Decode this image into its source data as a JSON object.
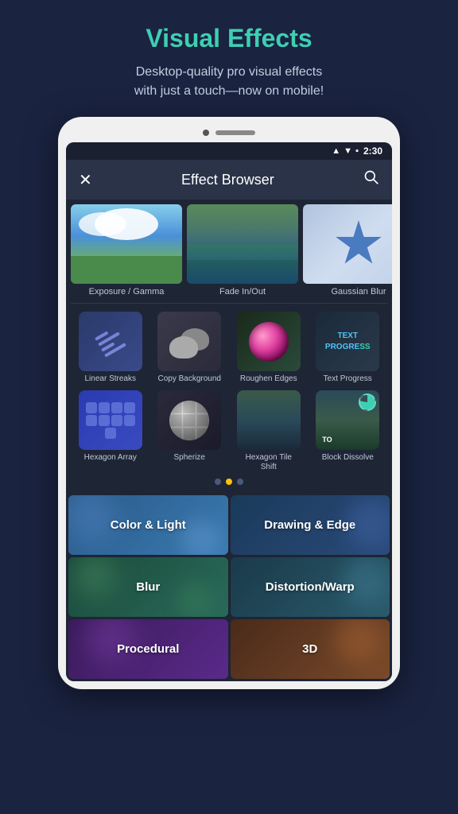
{
  "page": {
    "title": "Visual Effects",
    "subtitle": "Desktop-quality pro visual effects\nwith just a touch—now on mobile!"
  },
  "statusBar": {
    "time": "2:30"
  },
  "appBar": {
    "title": "Effect Browser",
    "closeIcon": "×",
    "searchIcon": "🔍"
  },
  "featuredEffects": [
    {
      "name": "Exposure / Gamma",
      "thumb": "sky"
    },
    {
      "name": "Fade In/Out",
      "thumb": "lake"
    },
    {
      "name": "Gaussian Blur",
      "thumb": "star"
    }
  ],
  "gridEffects": [
    {
      "name": "Linear Streaks",
      "thumb": "linear"
    },
    {
      "name": "Copy Background",
      "thumb": "copy"
    },
    {
      "name": "Roughen Edges",
      "thumb": "roughen"
    },
    {
      "name": "Text Progress",
      "thumb": "text"
    },
    {
      "name": "Hexagon Array",
      "thumb": "hexarray"
    },
    {
      "name": "Spherize",
      "thumb": "sphere"
    },
    {
      "name": "Hexagon Tile Shift",
      "thumb": "hextile"
    },
    {
      "name": "Block Dissolve",
      "thumb": "blockdissolve"
    }
  ],
  "dots": [
    {
      "active": false
    },
    {
      "active": true
    },
    {
      "active": false
    }
  ],
  "categories": [
    {
      "name": "Color & Light",
      "style": "light"
    },
    {
      "name": "Drawing & Edge",
      "style": "drawing"
    },
    {
      "name": "Blur",
      "style": "blur"
    },
    {
      "name": "Distortion/Warp",
      "style": "distort"
    },
    {
      "name": "Procedural",
      "style": "proc"
    },
    {
      "name": "3D",
      "style": "3d"
    }
  ]
}
